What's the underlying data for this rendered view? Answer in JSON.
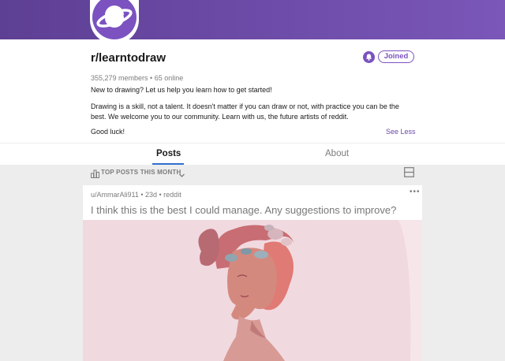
{
  "subreddit": {
    "name": "r/learntodraw",
    "members_line": "355,279 members • 65 online",
    "joined_label": "Joined",
    "description": [
      "New to drawing? Let us help you learn how to get started!",
      "Drawing is a skill, not a talent. It doesn't matter if you can draw or not, with practice you can be the best. We welcome you to our community. Learn with us, the future artists of reddit.",
      "Good luck!"
    ],
    "see_less_label": "See Less"
  },
  "tabs": [
    {
      "label": "Posts",
      "active": true
    },
    {
      "label": "About",
      "active": false
    }
  ],
  "sort": {
    "label": "TOP POSTS THIS MONTH"
  },
  "post": {
    "meta": "u/AmmarAli911 • 23d • reddit",
    "title": "I think this is the best I could manage. Any suggestions to improve?",
    "more": "•••"
  },
  "colors": {
    "banner": "#6b4aa6",
    "accent": "#7b52c0",
    "link": "#2f6fcf",
    "feed_bg": "#ededed"
  },
  "icons": [
    "planet-icon",
    "bell-icon",
    "top-posts-icon",
    "chevron-down-icon",
    "card-layout-icon",
    "more-icon"
  ]
}
